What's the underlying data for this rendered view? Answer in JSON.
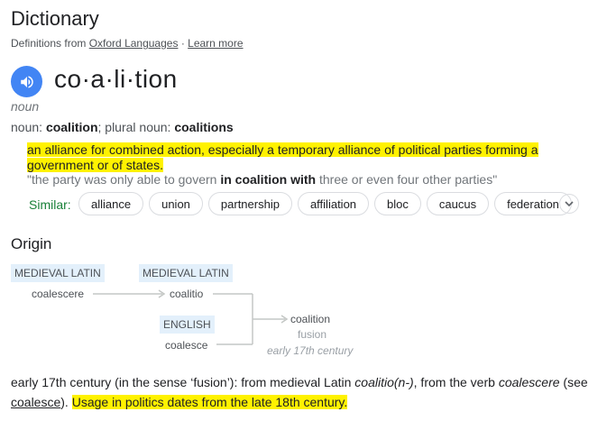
{
  "header": {
    "title": "Dictionary",
    "source_prefix": "Definitions from",
    "source_link": "Oxford Languages",
    "separator": "·",
    "learn_more": "Learn more"
  },
  "entry": {
    "headword": "co·a·li·tion",
    "part_of_speech": "noun",
    "noun_label": "noun:",
    "noun_form": "coalition",
    "plural_label": "; plural noun:",
    "plural_form": "coalitions"
  },
  "definition": {
    "line1": "an alliance for combined action, especially a temporary alliance of political parties forming a",
    "line2": "government or of states.",
    "example_pre": "\"the party was only able to govern",
    "example_bold": "in coalition with",
    "example_post": "three or even four other parties\""
  },
  "similar": {
    "label": "Similar:",
    "chips": [
      "alliance",
      "union",
      "partnership",
      "affiliation",
      "bloc",
      "caucus",
      "federation"
    ]
  },
  "origin": {
    "title": "Origin",
    "lang_medieval_latin_1": "MEDIEVAL LATIN",
    "lang_medieval_latin_2": "MEDIEVAL LATIN",
    "lang_english": "ENGLISH",
    "word_coalescere": "coalescere",
    "word_coalitio": "coalitio",
    "word_coalesce": "coalesce",
    "word_coalition": "coalition",
    "word_fusion": "fusion",
    "date": "early 17th century"
  },
  "etymology": {
    "part1": "early 17th century (in the sense ‘fusion’): from medieval Latin ",
    "italic1": "coalitio(n-)",
    "part2": ", from the verb ",
    "italic2": "coalescere",
    "part3": " (see",
    "link": "coalesce",
    "part4": "). ",
    "highlight": "Usage in politics dates from the late 18th century."
  },
  "colors": {
    "highlight": "#fff200",
    "accent_blue": "#4285f4",
    "similar_green": "#188038",
    "lang_tag_bg": "#e3f0fb"
  }
}
